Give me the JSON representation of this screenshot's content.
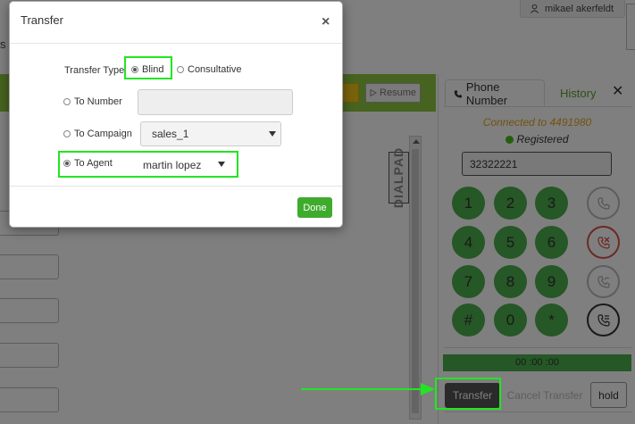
{
  "header": {
    "user_name": "mikael akerfeldt",
    "left_fragment": "s"
  },
  "toolbar": {
    "resume_label": "Resume"
  },
  "side_tag": "DIALPAD",
  "phone": {
    "tabs": [
      {
        "label": "Phone Number"
      },
      {
        "label": "History"
      }
    ],
    "close_glyph": "✕",
    "connected_text": "Connected to 4491980",
    "status_text": "Registered",
    "status_color": "#4cbb17",
    "number_value": "32322221",
    "keys": [
      "1",
      "2",
      "3",
      "4",
      "5",
      "6",
      "7",
      "8",
      "9",
      "#",
      "0",
      "*"
    ],
    "actions": [
      "phone-icon",
      "hangup-icon",
      "phone-forward-icon",
      "transfer-call-icon"
    ],
    "timer": "00 :00 :00",
    "buttons": {
      "transfer": "Transfer",
      "cancel_transfer": "Cancel Transfer",
      "hold": "hold"
    }
  },
  "modal": {
    "title": "Transfer",
    "close_glyph": "×",
    "transfer_type_label": "Transfer Type",
    "options": {
      "blind": "Blind",
      "consultative": "Consultative"
    },
    "to_number_label": "To Number",
    "to_number_value": "",
    "to_campaign_label": "To Campaign",
    "campaign_selected": "sales_1",
    "to_agent_label": "To Agent",
    "agent_selected": "martin lopez",
    "done_label": "Done"
  },
  "colors": {
    "accent_green": "#8dc63f",
    "highlight": "#22e522",
    "done_green": "#3fab2d",
    "connected_orange": "#e8a21d"
  }
}
